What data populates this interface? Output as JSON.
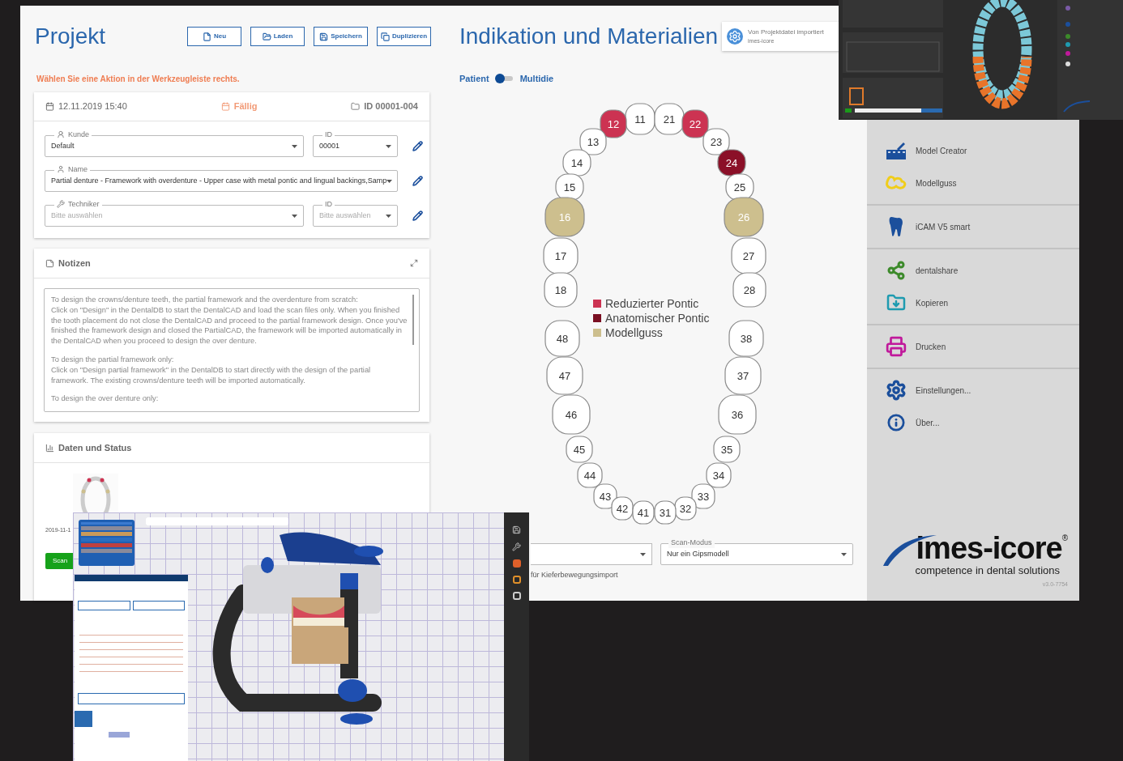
{
  "project": {
    "title": "Projekt",
    "buttons": [
      "Neu",
      "Laden",
      "Speichern",
      "Duplizieren"
    ],
    "hint": "Wählen Sie eine Aktion in der Werkzeugleiste rechts.",
    "info": {
      "date": "12.11.2019 15:40",
      "due": "Fällig",
      "id": "ID 00001-004"
    },
    "fields": [
      {
        "label": "Kunde",
        "value": "Default",
        "id_label": "ID",
        "id_value": "00001"
      },
      {
        "label": "Name",
        "value": "Partial denture - Framework with overdenture - Upper case with metal pontic and lingual backings,Samp"
      },
      {
        "label": "Techniker",
        "placeholder": "Bitte auswählen",
        "id_label": "ID",
        "id_placeholder": "Bitte auswählen"
      }
    ],
    "notes": {
      "title": "Notizen",
      "paragraphs": [
        "To design the crowns/denture teeth, the partial framework and the overdenture from scratch:\nClick on \"Design\" in the DentalDB to start the DentalCAD and load the scan files only. When you finished the tooth placement do not close the DentalCAD and proceed to the partial framework design. Once you've finished the framework design and closed the PartialCAD, the framework will be imported automatically in the DentalCAD when you proceed to design the over denture.",
        "To design the partial framework only:\nClick on \"Design partial framework\" in the DentalDB to start directly with the design of the partial framework. The existing crowns/denture teeth will be imported automatically.",
        "To design the over denture only:"
      ]
    },
    "status": {
      "title": "Daten und Status",
      "date": "2019-11-1",
      "scan_button": "Scan"
    }
  },
  "indication": {
    "title": "Indikation und Materialien",
    "import": {
      "title": "Von Projektdatei importiert",
      "source": "imes-icore"
    },
    "toggle": {
      "left": "Patient",
      "right": "Multidie",
      "on": false
    },
    "teeth": [
      {
        "number": "11"
      },
      {
        "number": "21"
      },
      {
        "number": "12",
        "color": "#cc3352"
      },
      {
        "number": "22",
        "color": "#cc3352"
      },
      {
        "number": "13"
      },
      {
        "number": "23"
      },
      {
        "number": "14"
      },
      {
        "number": "24",
        "color": "#8b1028"
      },
      {
        "number": "15"
      },
      {
        "number": "25"
      },
      {
        "number": "16",
        "color": "#cdbf8e"
      },
      {
        "number": "26",
        "color": "#cdbf8e"
      },
      {
        "number": "17"
      },
      {
        "number": "27"
      },
      {
        "number": "18"
      },
      {
        "number": "28"
      },
      {
        "number": "48"
      },
      {
        "number": "38"
      },
      {
        "number": "47"
      },
      {
        "number": "37"
      },
      {
        "number": "46"
      },
      {
        "number": "36"
      },
      {
        "number": "45"
      },
      {
        "number": "35"
      },
      {
        "number": "44"
      },
      {
        "number": "34"
      },
      {
        "number": "43"
      },
      {
        "number": "33"
      },
      {
        "number": "42"
      },
      {
        "number": "32"
      },
      {
        "number": "41"
      },
      {
        "number": "31"
      }
    ],
    "legend": [
      {
        "label": "Reduzierter Pontic",
        "color": "#cc3352"
      },
      {
        "label": "Anatomischer Pontic",
        "color": "#7a0f22"
      },
      {
        "label": "Modellguss",
        "color": "#cdbf8e"
      }
    ],
    "scan_mode": {
      "label": "Scan-Modus",
      "value": "Nur ein Gipsmodell"
    },
    "checkbox_text": "für Kieferbewegungsimport"
  },
  "sidebar": {
    "groups": [
      {
        "items": [
          "Model Creator",
          "Modellguss"
        ]
      },
      {
        "items": [
          "iCAM V5 smart"
        ]
      },
      {
        "items": [
          "dentalshare",
          "Kopieren"
        ]
      },
      {
        "items": [
          "Drucken"
        ]
      },
      {
        "items": [
          "Einstellungen...",
          "Über..."
        ]
      }
    ],
    "logo": {
      "name": "imes-icore",
      "registered": "®",
      "tagline": "competence in dental solutions"
    },
    "version": "v3.0-7754"
  }
}
